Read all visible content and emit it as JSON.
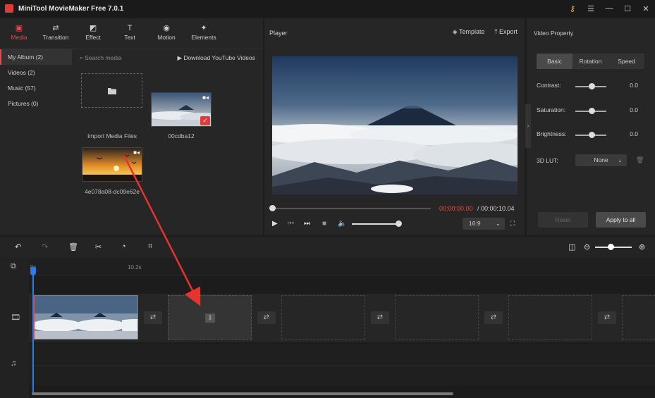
{
  "app": {
    "title": "MiniTool MovieMaker Free 7.0.1",
    "brand_color": "#e03a3a"
  },
  "window_controls": {
    "key": "⚷",
    "menu": "☰",
    "minimize": "—",
    "maximize": "☐",
    "close": "✕"
  },
  "toolbar": {
    "items": [
      {
        "label": "Media",
        "icon": "media-folder-icon",
        "glyph": "▣"
      },
      {
        "label": "Transition",
        "icon": "transition-icon",
        "glyph": "⇄"
      },
      {
        "label": "Effect",
        "icon": "effect-icon",
        "glyph": "◩"
      },
      {
        "label": "Text",
        "icon": "text-icon",
        "glyph": "T"
      },
      {
        "label": "Motion",
        "icon": "motion-icon",
        "glyph": "◉"
      },
      {
        "label": "Elements",
        "icon": "elements-icon",
        "glyph": "✦"
      }
    ]
  },
  "sidebar": {
    "items": [
      {
        "label": "My Album (2)"
      },
      {
        "label": "Videos (2)"
      },
      {
        "label": "Music (57)"
      },
      {
        "label": "Pictures (0)"
      }
    ]
  },
  "media": {
    "search_placeholder": "Search media",
    "download_label": "Download YouTube Videos",
    "import_label": "Import Media Files",
    "files": [
      {
        "name": "00cdba12",
        "added": true
      },
      {
        "name": "4e078a08-dc09e62e",
        "added": false
      }
    ]
  },
  "player": {
    "title": "Player",
    "template_label": "Template",
    "export_label": "Export",
    "time_current": "00:00:00.00",
    "time_separator": " / ",
    "time_total": "00:00:10.04",
    "aspect_ratio": "16:9",
    "progress": 0.0,
    "volume": 1.0
  },
  "properties": {
    "title": "Video Property",
    "tabs": [
      "Basic",
      "Rotation",
      "Speed"
    ],
    "active_tab": "Basic",
    "rows": [
      {
        "label": "Contrast:",
        "value": "0.0"
      },
      {
        "label": "Saturation:",
        "value": "0.0"
      },
      {
        "label": "Brightness:",
        "value": "0.0"
      }
    ],
    "lut_label": "3D LUT:",
    "lut_value": "None",
    "reset_label": "Reset",
    "apply_label": "Apply to all"
  },
  "timeline": {
    "ruler": [
      "0s",
      "10.2s"
    ],
    "zoom": 0.5
  },
  "colors": {
    "accent": "#e84a4a",
    "playhead": "#2f7be6",
    "panel": "#262626",
    "background": "#1c1c1c"
  }
}
